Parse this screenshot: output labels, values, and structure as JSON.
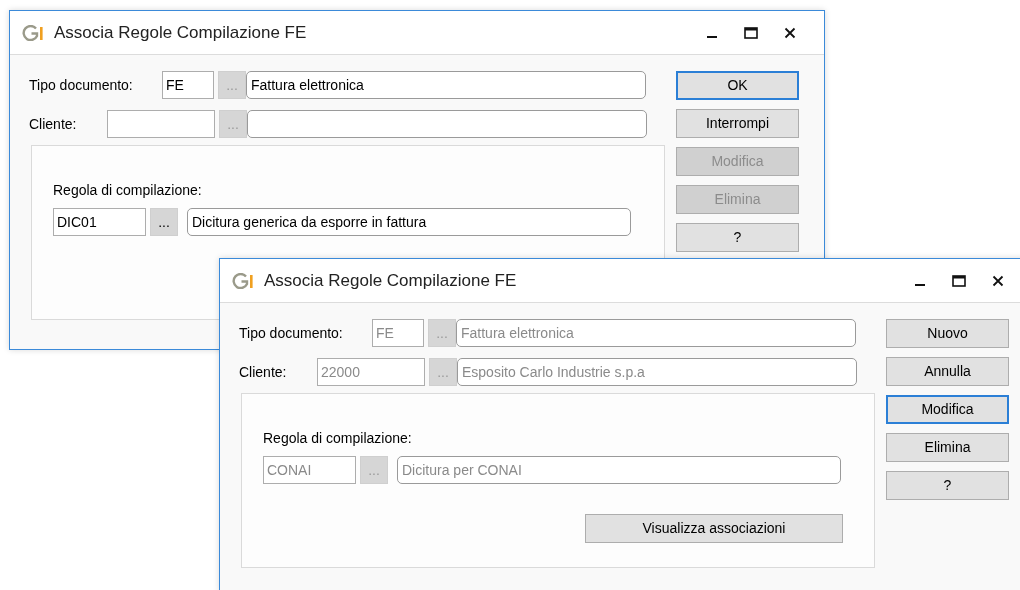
{
  "windows": [
    {
      "title": "Associa Regole Compilazione FE",
      "fields": [
        {
          "label": "Tipo documento:",
          "code": "FE",
          "browse_label": "...",
          "description": "Fattura elettronica",
          "disabled": false,
          "browse_disabled": true
        },
        {
          "label": "Cliente:",
          "browse_label": "...",
          "disabled": false,
          "browse_disabled": true
        }
      ],
      "rule": {
        "label": "Regola di compilazione:",
        "code": "DIC01",
        "browse_label": "...",
        "description": "Dicitura generica da esporre in fattura",
        "disabled": false,
        "browse_disabled": false
      },
      "buttons": [
        {
          "label": "OK",
          "disabled": false,
          "focused": true
        },
        {
          "label": "Interrompi",
          "disabled": false,
          "focused": false
        },
        {
          "label": "Modifica",
          "disabled": true,
          "focused": false
        },
        {
          "label": "Elimina",
          "disabled": true,
          "focused": false
        },
        {
          "label": "?",
          "disabled": false,
          "focused": false
        }
      ]
    },
    {
      "title": "Associa Regole Compilazione FE",
      "fields": [
        {
          "label": "Tipo documento:",
          "code": "FE",
          "browse_label": "...",
          "description": "Fattura elettronica",
          "disabled": true,
          "browse_disabled": true
        },
        {
          "label": "Cliente:",
          "code": "22000",
          "browse_label": "...",
          "description": "Esposito Carlo Industrie s.p.a",
          "disabled": true,
          "browse_disabled": true
        }
      ],
      "rule": {
        "label": "Regola di compilazione:",
        "code": "CONAI",
        "browse_label": "...",
        "description": "Dicitura per CONAI",
        "disabled": true,
        "browse_disabled": true
      },
      "panel_button": "Visualizza associazioni",
      "buttons": [
        {
          "label": "Nuovo",
          "disabled": false,
          "focused": false
        },
        {
          "label": "Annulla",
          "disabled": false,
          "focused": false
        },
        {
          "label": "Modifica",
          "disabled": false,
          "focused": true
        },
        {
          "label": "Elimina",
          "disabled": false,
          "focused": false
        },
        {
          "label": "?",
          "disabled": false,
          "focused": false
        }
      ]
    }
  ]
}
